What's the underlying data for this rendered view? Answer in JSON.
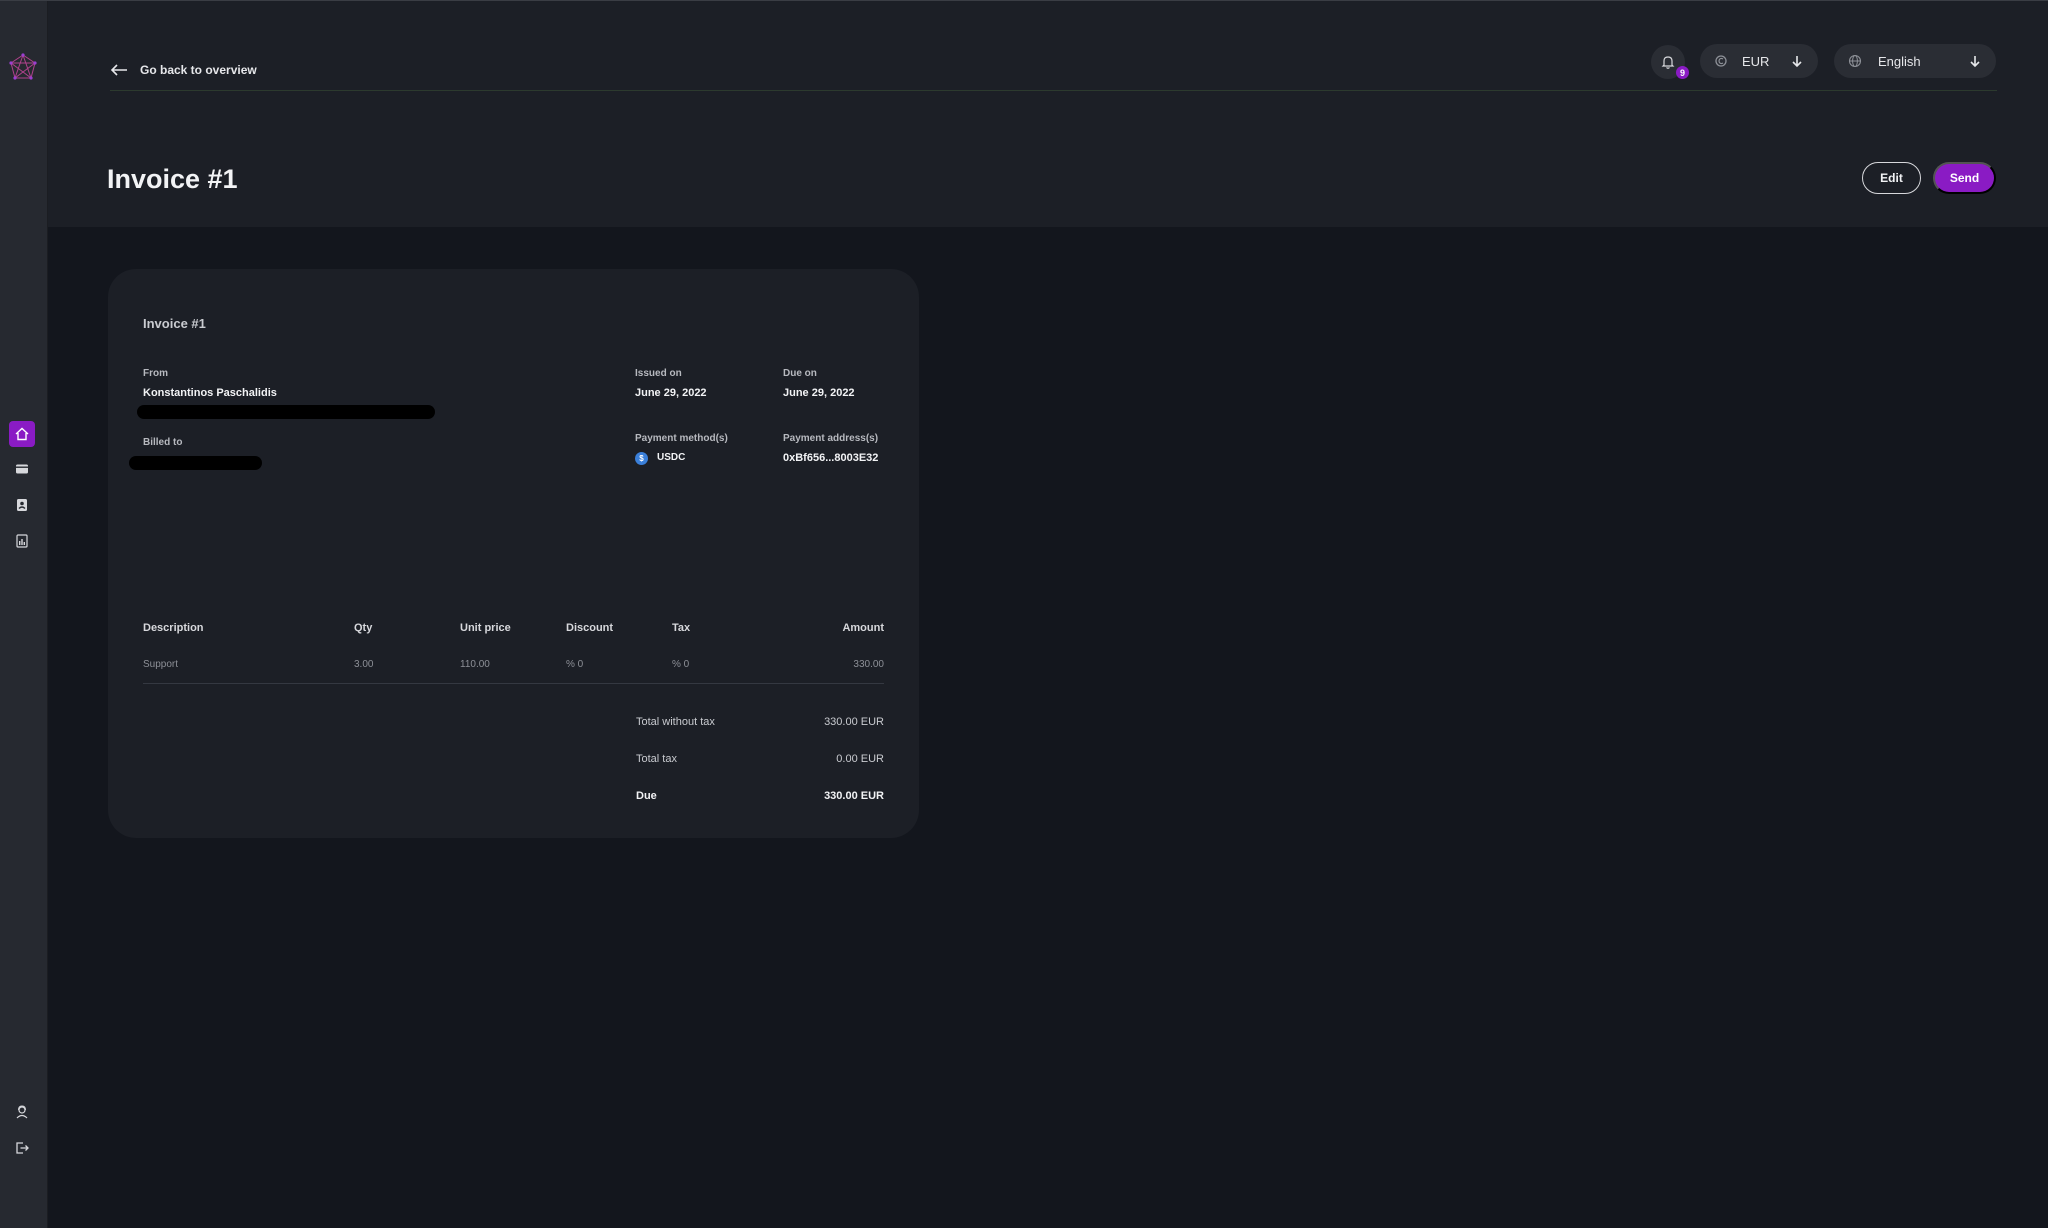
{
  "header": {
    "back_label": "Go back to overview",
    "notification_count": "9",
    "currency": "EUR",
    "language": "English"
  },
  "page": {
    "title": "Invoice #1",
    "edit_label": "Edit",
    "send_label": "Send"
  },
  "invoice": {
    "title": "Invoice #1",
    "from_label": "From",
    "from_name": "Konstantinos Paschalidis",
    "billed_to_label": "Billed to",
    "issued_on_label": "Issued on",
    "issued_on": "June 29, 2022",
    "due_on_label": "Due on",
    "due_on": "June 29, 2022",
    "payment_method_label": "Payment method(s)",
    "payment_method": "USDC",
    "payment_address_label": "Payment address(s)",
    "payment_address": "0xBf656...8003E32",
    "columns": [
      "Description",
      "Qty",
      "Unit price",
      "Discount",
      "Tax",
      "Amount"
    ],
    "items": [
      {
        "description": "Support",
        "qty": "3.00",
        "unit_price": "110.00",
        "discount": "% 0",
        "tax": "% 0",
        "amount": "330.00"
      }
    ],
    "totals": {
      "without_tax_label": "Total without tax",
      "without_tax": "330.00 EUR",
      "tax_label": "Total tax",
      "tax": "0.00 EUR",
      "due_label": "Due",
      "due": "330.00 EUR"
    }
  },
  "colors": {
    "accent": "#8a1bc4",
    "background": "#13161d",
    "panel": "#1c1f26",
    "sidebar": "#262930"
  },
  "icons": {
    "logo": "network-logo-icon",
    "nav": [
      "home-icon",
      "wallet-icon",
      "contacts-icon",
      "report-icon"
    ],
    "bottom": [
      "support-agent-icon",
      "logout-icon"
    ]
  }
}
